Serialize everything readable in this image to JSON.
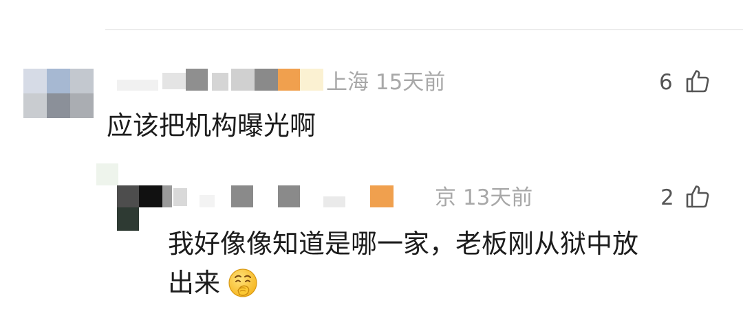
{
  "comments": [
    {
      "location_time": "上海 15天前",
      "like_count": "6",
      "text": "应该把机构曝光啊"
    },
    {
      "location_time": "京 13天前",
      "like_count": "2",
      "text_line1": "我好像像知道是哪一家，老板刚从狱中放",
      "text_line2": "出来",
      "emoji": "thinking-hand-over-mouth-emoji"
    }
  ],
  "icons": {
    "like": "thumbs-up-outline-icon"
  },
  "colors": {
    "meta_text": "#a8a8a8",
    "body_text": "#1c1c1c",
    "orange_badge": "#f0a04e"
  }
}
